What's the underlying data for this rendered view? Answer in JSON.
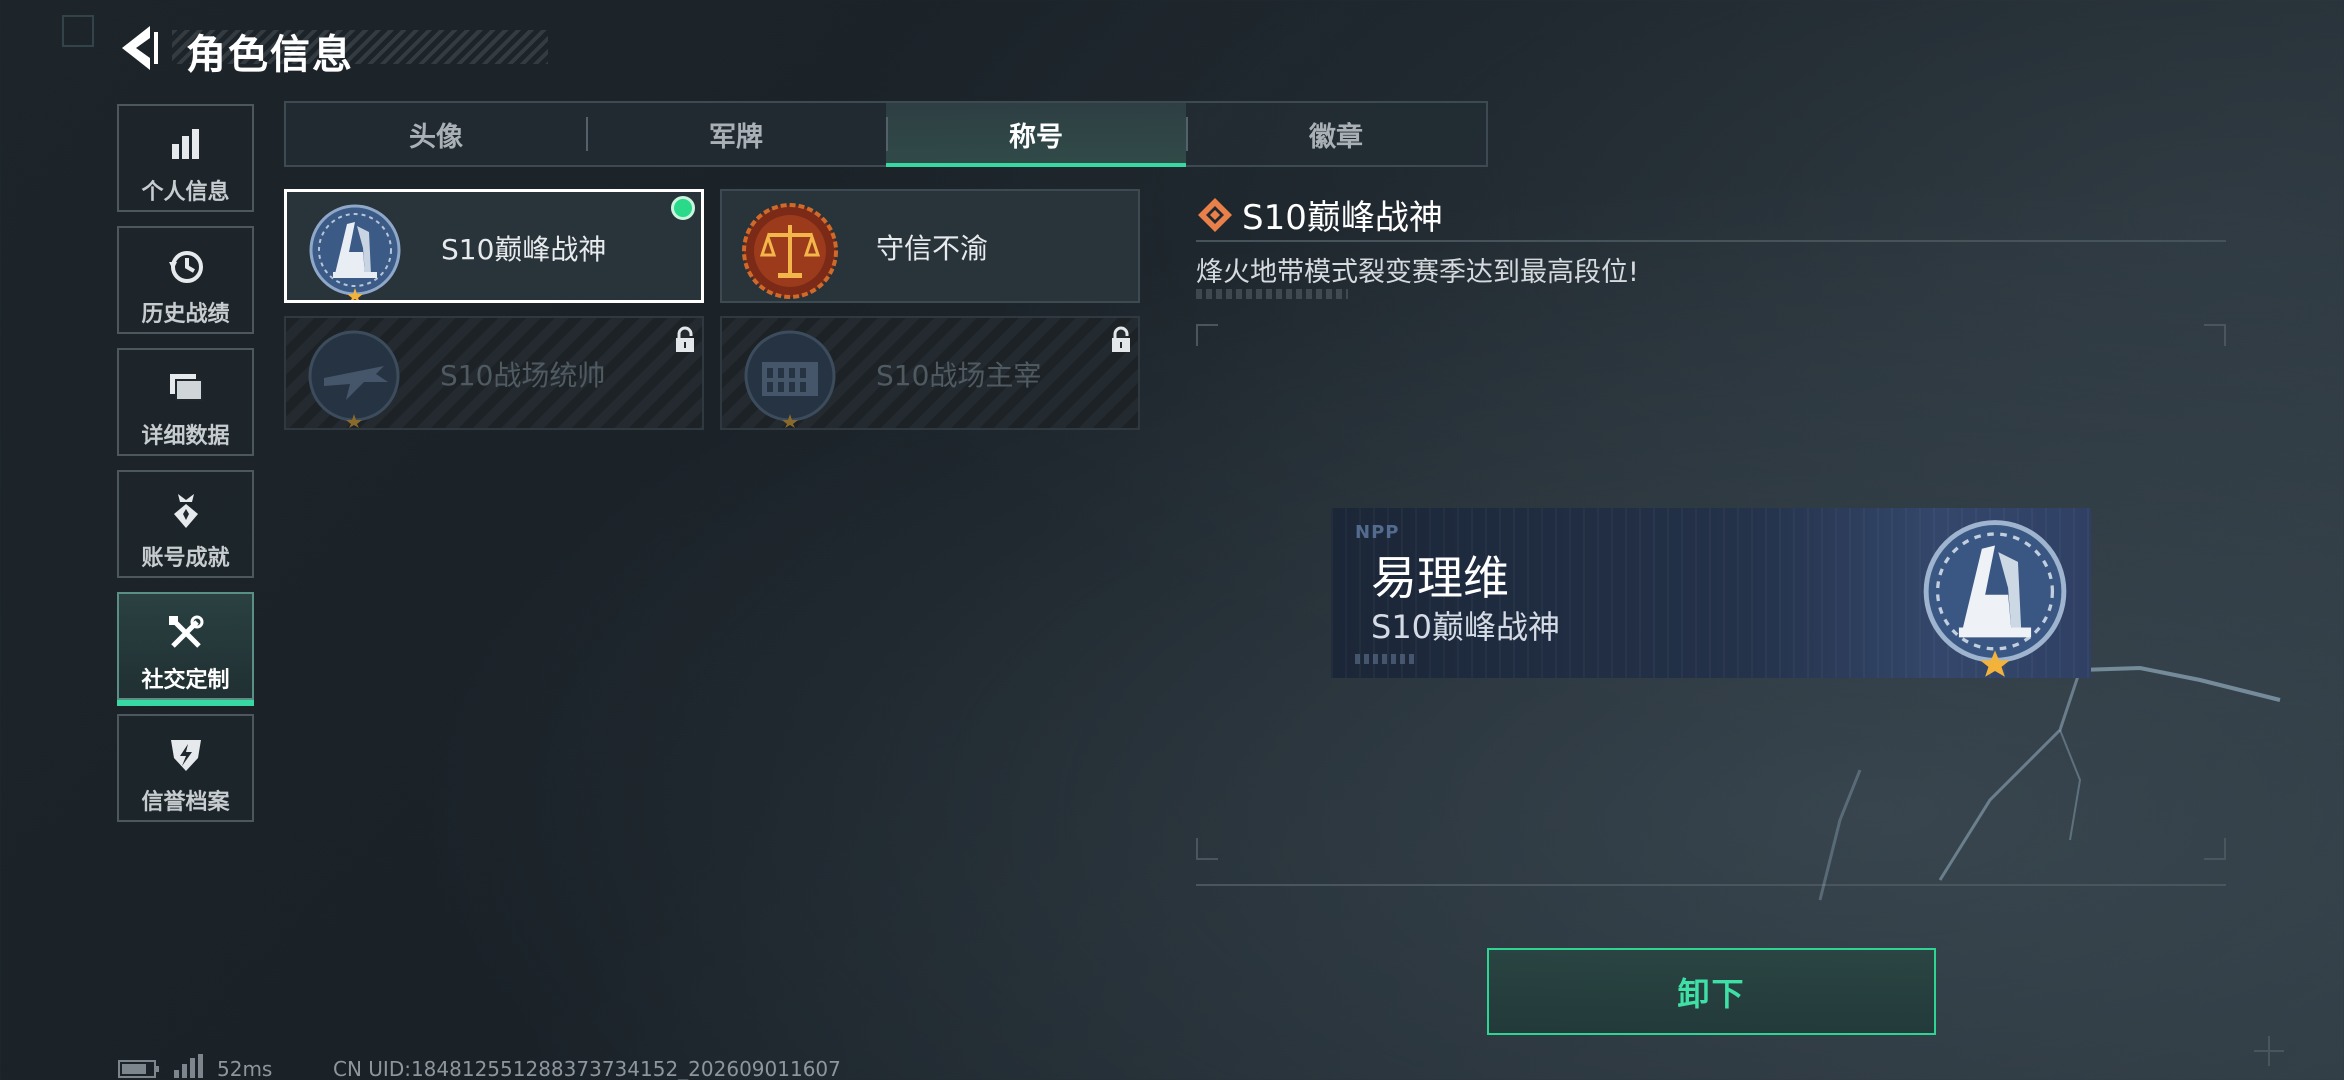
{
  "header": {
    "title": "角色信息",
    "back_icon": "back-arrow-icon"
  },
  "sidebar": {
    "items": [
      {
        "label": "个人信息",
        "icon": "bar-chart-icon",
        "active": false
      },
      {
        "label": "历史战绩",
        "icon": "history-icon",
        "active": false
      },
      {
        "label": "详细数据",
        "icon": "folders-icon",
        "active": false
      },
      {
        "label": "账号成就",
        "icon": "medal-icon",
        "active": false
      },
      {
        "label": "社交定制",
        "icon": "tools-icon",
        "active": true
      },
      {
        "label": "信誉档案",
        "icon": "shield-lightning-icon",
        "active": false
      }
    ]
  },
  "tabs": [
    {
      "label": "头像",
      "active": false
    },
    {
      "label": "军牌",
      "active": false
    },
    {
      "label": "称号",
      "active": true
    },
    {
      "label": "徽章",
      "active": false
    }
  ],
  "titles": [
    {
      "name": "S10巅峰战神",
      "selected": true,
      "equipped": true,
      "locked": false
    },
    {
      "name": "守信不渝",
      "selected": false,
      "equipped": false,
      "locked": false
    },
    {
      "name": "S10战场统帅",
      "selected": false,
      "equipped": false,
      "locked": true
    },
    {
      "name": "S10战场主宰",
      "selected": false,
      "equipped": false,
      "locked": true
    }
  ],
  "detail": {
    "title": "S10巅峰战神",
    "description": "烽火地带模式裂变赛季达到最高段位!"
  },
  "nameplate": {
    "logo": "NPP",
    "player_name": "易理维",
    "title": "S10巅峰战神"
  },
  "actions": {
    "unequip_label": "卸下"
  },
  "status": {
    "ping": "52ms",
    "uid": "CN UID:18481255128837373​4152_202609011607"
  },
  "colors": {
    "accent": "#37d8a2",
    "equipped_dot": "#2bd98a",
    "background": "#1d252b"
  }
}
